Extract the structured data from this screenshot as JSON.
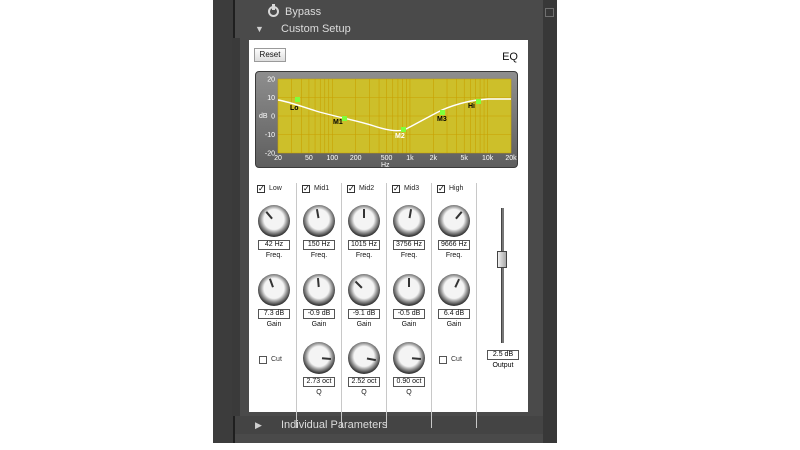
{
  "header": {
    "bypass_label": "Bypass",
    "custom_setup_label": "Custom Setup"
  },
  "footer": {
    "individual_parameters_label": "Individual Parameters"
  },
  "eq": {
    "reset_label": "Reset",
    "title": "EQ",
    "graph": {
      "y_label": "dB",
      "x_label": "Hz",
      "y_ticks": [
        "20",
        "10",
        "0",
        "-10",
        "-20"
      ],
      "x_ticks": [
        "20",
        "50",
        "100",
        "200",
        "500",
        "1k",
        "2k",
        "5k",
        "10k",
        "20k"
      ],
      "node_labels": [
        "Lo",
        "M1",
        "M2",
        "M3",
        "Hi"
      ],
      "grid_color": "#c9a000",
      "bg_color": "#cdbf2a"
    },
    "bands": [
      {
        "name": "Low",
        "checked": true,
        "freq": "42 Hz",
        "gain": "7.3 dB",
        "q": null
      },
      {
        "name": "Mid1",
        "checked": true,
        "freq": "150 Hz",
        "gain": "-0.9 dB",
        "q": "2.73 oct"
      },
      {
        "name": "Mid2",
        "checked": true,
        "freq": "1015 Hz",
        "gain": "-9.1 dB",
        "q": "2.52 oct"
      },
      {
        "name": "Mid3",
        "checked": true,
        "freq": "3756 Hz",
        "gain": "-0.5 dB",
        "q": "0.90 oct"
      },
      {
        "name": "High",
        "checked": true,
        "freq": "9666 Hz",
        "gain": "6.4 dB",
        "q": null
      }
    ],
    "labels": {
      "freq": "Freq.",
      "gain": "Gain",
      "q": "Q",
      "cut": "Cut",
      "output": "Output"
    },
    "output_value": "2.5 dB",
    "output_level_fraction": 0.62
  }
}
